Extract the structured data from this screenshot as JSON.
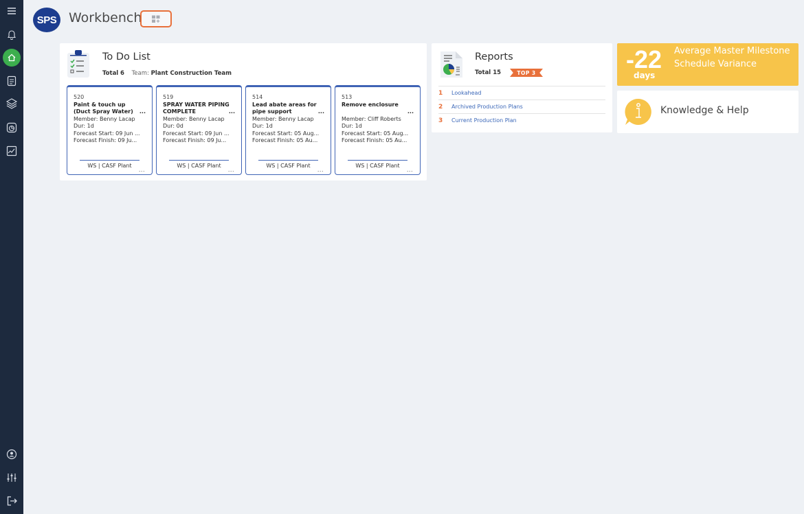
{
  "header": {
    "logo_text": "SPS",
    "title": "Workbench"
  },
  "sidebar": {
    "items": [
      {
        "name": "menu-icon"
      },
      {
        "name": "bell-icon"
      },
      {
        "name": "home-icon",
        "active": true
      },
      {
        "name": "document-icon"
      },
      {
        "name": "layers-icon"
      },
      {
        "name": "report-icon"
      },
      {
        "name": "chart-icon"
      },
      {
        "name": "user-icon"
      },
      {
        "name": "sliders-icon"
      },
      {
        "name": "logout-icon"
      }
    ],
    "active_color": "#3cae4e"
  },
  "todo": {
    "title": "To Do List",
    "total_label": "Total",
    "total": "6",
    "team_label": "Team:",
    "team": "Plant Construction Team",
    "tasks": [
      {
        "id": "520",
        "name": "Paint & touch up (Duct Spray Water)",
        "dots": "...",
        "member": "Member: Benny Lacap",
        "dur": "Dur: 1d",
        "start": "Forecast Start: 09 Jun ...",
        "finish": "Forecast Finish: 09 Ju...",
        "footer": "WS | CASF Plant",
        "more": "..."
      },
      {
        "id": "519",
        "name": "SPRAY WATER PIPING COMPLETE",
        "dots": "...",
        "member": "Member: Benny Lacap",
        "dur": "Dur: 0d",
        "start": "Forecast Start: 09 Jun ...",
        "finish": "Forecast Finish: 09 Ju...",
        "footer": "WS | CASF Plant",
        "more": "..."
      },
      {
        "id": "514",
        "name": "Lead abate areas for pipe support",
        "dots": "...",
        "member": "Member: Benny Lacap",
        "dur": "Dur: 1d",
        "start": "Forecast Start: 05 Aug...",
        "finish": "Forecast Finish: 05 Au...",
        "footer": "WS | CASF Plant",
        "more": "..."
      },
      {
        "id": "513",
        "name": "Remove enclosure",
        "dots": "...",
        "member": "Member: Cliff Roberts",
        "dur": "Dur: 1d",
        "start": "Forecast Start: 05 Aug...",
        "finish": "Forecast Finish: 05 Au...",
        "footer": "WS | CASF Plant",
        "more": "..."
      }
    ]
  },
  "reports": {
    "title": "Reports",
    "total_label": "Total",
    "total": "15",
    "badge": "TOP 3",
    "items": [
      {
        "num": "1",
        "label": "Lookahead"
      },
      {
        "num": "2",
        "label": "Archived Production Plans"
      },
      {
        "num": "3",
        "label": "Current Production Plan"
      }
    ]
  },
  "variance": {
    "value": "-22",
    "unit": "days",
    "label": "Average Master Milestone Schedule Variance",
    "color": "#f7c44a"
  },
  "knowledge": {
    "title": "Knowledge & Help"
  },
  "colors": {
    "accent": "#e8703a",
    "task_border": "#3f63b5",
    "link": "#3b67b8",
    "sidebar_bg": "#1d2a3e"
  }
}
